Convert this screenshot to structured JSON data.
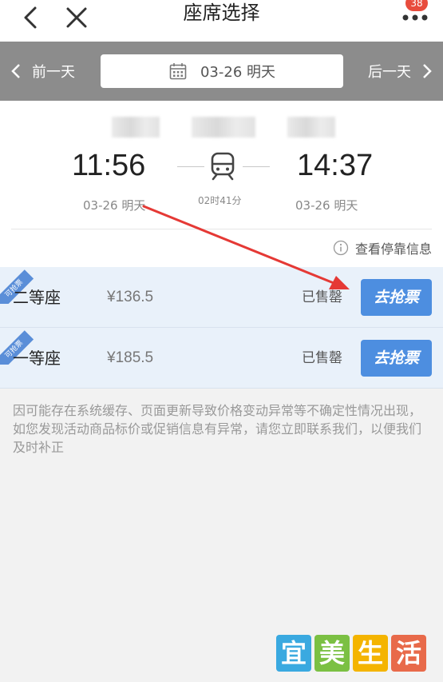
{
  "header": {
    "title": "座席选择",
    "badge": "38"
  },
  "datebar": {
    "prev_label": "前一天",
    "date_label": "03-26 明天",
    "next_label": "后一天"
  },
  "train": {
    "depart_time": "11:56",
    "arrive_time": "14:37",
    "depart_date": "03-26 明天",
    "arrive_date": "03-26 明天",
    "duration": "02时41分",
    "stop_info_label": "查看停靠信息"
  },
  "seats": [
    {
      "ribbon": "可抢票",
      "name": "二等座",
      "price": "¥136.5",
      "status": "已售罄",
      "button": "去抢票"
    },
    {
      "ribbon": "可抢票",
      "name": "一等座",
      "price": "¥185.5",
      "status": "已售罄",
      "button": "去抢票"
    }
  ],
  "notice": "因可能存在系统缓存、页面更新导致价格变动异常等不确定性情况出现，如您发现活动商品标价或促销信息有异常，请您立即联系我们，以便我们及时补正",
  "watermark": {
    "chars": [
      "宜",
      "美",
      "生",
      "活"
    ],
    "colors": [
      "#3aa9e0",
      "#7bc043",
      "#f4b400",
      "#e86a4a"
    ]
  },
  "colors": {
    "accent": "#4d8ee0",
    "datebar": "#8c8c8c",
    "arrow": "#e53935"
  }
}
